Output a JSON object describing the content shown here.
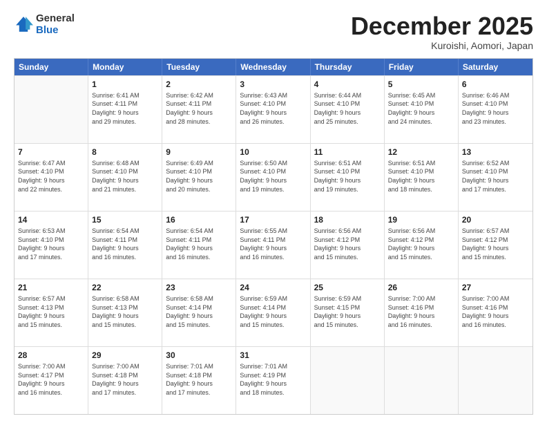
{
  "header": {
    "logo_general": "General",
    "logo_blue": "Blue",
    "month_title": "December 2025",
    "subtitle": "Kuroishi, Aomori, Japan"
  },
  "weekdays": [
    "Sunday",
    "Monday",
    "Tuesday",
    "Wednesday",
    "Thursday",
    "Friday",
    "Saturday"
  ],
  "weeks": [
    [
      {
        "day": "",
        "empty": true
      },
      {
        "day": "1",
        "sunrise": "6:41 AM",
        "sunset": "4:11 PM",
        "daylight": "9 hours and 29 minutes."
      },
      {
        "day": "2",
        "sunrise": "6:42 AM",
        "sunset": "4:11 PM",
        "daylight": "9 hours and 28 minutes."
      },
      {
        "day": "3",
        "sunrise": "6:43 AM",
        "sunset": "4:10 PM",
        "daylight": "9 hours and 26 minutes."
      },
      {
        "day": "4",
        "sunrise": "6:44 AM",
        "sunset": "4:10 PM",
        "daylight": "9 hours and 25 minutes."
      },
      {
        "day": "5",
        "sunrise": "6:45 AM",
        "sunset": "4:10 PM",
        "daylight": "9 hours and 24 minutes."
      },
      {
        "day": "6",
        "sunrise": "6:46 AM",
        "sunset": "4:10 PM",
        "daylight": "9 hours and 23 minutes."
      }
    ],
    [
      {
        "day": "7",
        "sunrise": "6:47 AM",
        "sunset": "4:10 PM",
        "daylight": "9 hours and 22 minutes."
      },
      {
        "day": "8",
        "sunrise": "6:48 AM",
        "sunset": "4:10 PM",
        "daylight": "9 hours and 21 minutes."
      },
      {
        "day": "9",
        "sunrise": "6:49 AM",
        "sunset": "4:10 PM",
        "daylight": "9 hours and 20 minutes."
      },
      {
        "day": "10",
        "sunrise": "6:50 AM",
        "sunset": "4:10 PM",
        "daylight": "9 hours and 19 minutes."
      },
      {
        "day": "11",
        "sunrise": "6:51 AM",
        "sunset": "4:10 PM",
        "daylight": "9 hours and 19 minutes."
      },
      {
        "day": "12",
        "sunrise": "6:51 AM",
        "sunset": "4:10 PM",
        "daylight": "9 hours and 18 minutes."
      },
      {
        "day": "13",
        "sunrise": "6:52 AM",
        "sunset": "4:10 PM",
        "daylight": "9 hours and 17 minutes."
      }
    ],
    [
      {
        "day": "14",
        "sunrise": "6:53 AM",
        "sunset": "4:10 PM",
        "daylight": "9 hours and 17 minutes."
      },
      {
        "day": "15",
        "sunrise": "6:54 AM",
        "sunset": "4:11 PM",
        "daylight": "9 hours and 16 minutes."
      },
      {
        "day": "16",
        "sunrise": "6:54 AM",
        "sunset": "4:11 PM",
        "daylight": "9 hours and 16 minutes."
      },
      {
        "day": "17",
        "sunrise": "6:55 AM",
        "sunset": "4:11 PM",
        "daylight": "9 hours and 16 minutes."
      },
      {
        "day": "18",
        "sunrise": "6:56 AM",
        "sunset": "4:12 PM",
        "daylight": "9 hours and 15 minutes."
      },
      {
        "day": "19",
        "sunrise": "6:56 AM",
        "sunset": "4:12 PM",
        "daylight": "9 hours and 15 minutes."
      },
      {
        "day": "20",
        "sunrise": "6:57 AM",
        "sunset": "4:12 PM",
        "daylight": "9 hours and 15 minutes."
      }
    ],
    [
      {
        "day": "21",
        "sunrise": "6:57 AM",
        "sunset": "4:13 PM",
        "daylight": "9 hours and 15 minutes."
      },
      {
        "day": "22",
        "sunrise": "6:58 AM",
        "sunset": "4:13 PM",
        "daylight": "9 hours and 15 minutes."
      },
      {
        "day": "23",
        "sunrise": "6:58 AM",
        "sunset": "4:14 PM",
        "daylight": "9 hours and 15 minutes."
      },
      {
        "day": "24",
        "sunrise": "6:59 AM",
        "sunset": "4:14 PM",
        "daylight": "9 hours and 15 minutes."
      },
      {
        "day": "25",
        "sunrise": "6:59 AM",
        "sunset": "4:15 PM",
        "daylight": "9 hours and 15 minutes."
      },
      {
        "day": "26",
        "sunrise": "7:00 AM",
        "sunset": "4:16 PM",
        "daylight": "9 hours and 16 minutes."
      },
      {
        "day": "27",
        "sunrise": "7:00 AM",
        "sunset": "4:16 PM",
        "daylight": "9 hours and 16 minutes."
      }
    ],
    [
      {
        "day": "28",
        "sunrise": "7:00 AM",
        "sunset": "4:17 PM",
        "daylight": "9 hours and 16 minutes."
      },
      {
        "day": "29",
        "sunrise": "7:00 AM",
        "sunset": "4:18 PM",
        "daylight": "9 hours and 17 minutes."
      },
      {
        "day": "30",
        "sunrise": "7:01 AM",
        "sunset": "4:18 PM",
        "daylight": "9 hours and 17 minutes."
      },
      {
        "day": "31",
        "sunrise": "7:01 AM",
        "sunset": "4:19 PM",
        "daylight": "9 hours and 18 minutes."
      },
      {
        "day": "",
        "empty": true
      },
      {
        "day": "",
        "empty": true
      },
      {
        "day": "",
        "empty": true
      }
    ]
  ]
}
